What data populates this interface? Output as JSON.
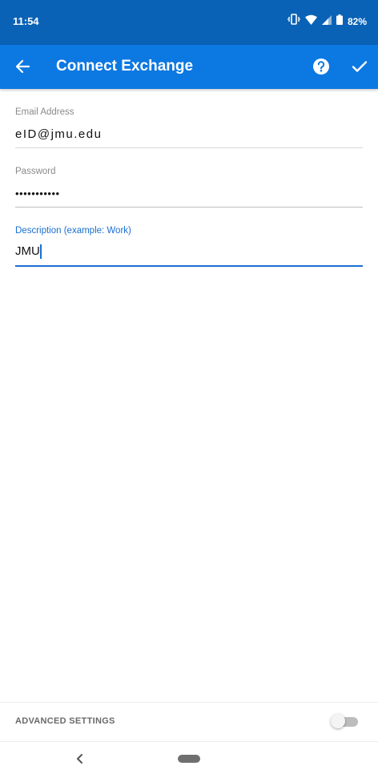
{
  "status_bar": {
    "time": "11:54",
    "battery": "82%"
  },
  "app_bar": {
    "title": "Connect Exchange"
  },
  "form": {
    "email": {
      "label": "Email Address",
      "value": "eID@jmu.edu"
    },
    "password": {
      "label": "Password",
      "value": "•••••••••••"
    },
    "description": {
      "label": "Description (example: Work)",
      "value": "JMU"
    }
  },
  "advanced": {
    "label": "ADVANCED SETTINGS",
    "enabled": false
  },
  "colors": {
    "status_bar": "#0a62b6",
    "app_bar": "#0c78e2",
    "accent": "#1a6fd0"
  }
}
